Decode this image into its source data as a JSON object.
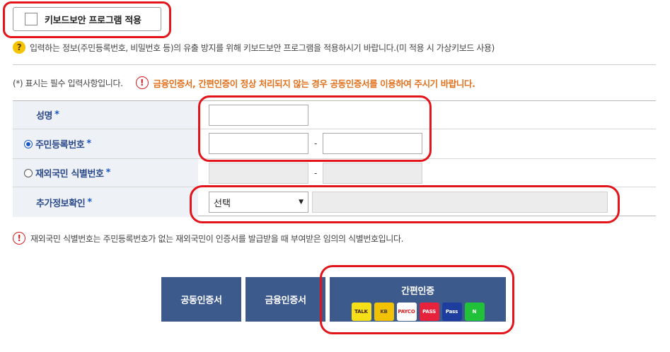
{
  "keyboard_security": {
    "label": "키보드보안 프로그램 적용"
  },
  "help": {
    "icon": "?",
    "text": "입력하는 정보(주민등록번호, 비밀번호 등)의 유출 방지를 위해 키보드보안 프로그램을 적용하시기 바랍니다.(미 적용 시 가상키보드 사용)"
  },
  "required_note": {
    "text": "(*) 표시는 필수 입력사항입니다.",
    "warning": "금융인증서, 간편인증이 정상 처리되지 않는 경우 공동인증서를 이용하여 주시기 바랍니다."
  },
  "form": {
    "rows": [
      {
        "label": "성명",
        "star": "*"
      },
      {
        "label": "주민등록번호",
        "star": "*"
      },
      {
        "label": "재외국민 식별번호",
        "star": "*"
      },
      {
        "label": "추가정보확인",
        "star": "*"
      }
    ],
    "dash": "-",
    "select_value": "선택",
    "select_caret": "▼"
  },
  "bottom_note": {
    "text": "재외국민 식별번호는 주민등록번호가 없는 재외국민이 인증서를 발급받을 때 부여받은 임의의 식별번호입니다."
  },
  "buttons": {
    "joint_cert": "공동인증서",
    "financial_cert": "금융인증서",
    "simple_auth": "간편인증"
  },
  "providers": [
    {
      "name": "kakao-icon",
      "label": "TALK",
      "bg": "#f7e017",
      "fg": "#3a1d1d"
    },
    {
      "name": "kb-icon",
      "label": "KB",
      "bg": "#f2c200",
      "fg": "#4a3b2a"
    },
    {
      "name": "payco-icon",
      "label": "PAYCO",
      "bg": "#ffffff",
      "fg": "#e2201f"
    },
    {
      "name": "pass-icon",
      "label": "PASS",
      "bg": "#e6223c",
      "fg": "#ffffff"
    },
    {
      "name": "samsung-pass-icon",
      "label": "Pass",
      "bg": "#1d3e9e",
      "fg": "#ffffff"
    },
    {
      "name": "naver-icon",
      "label": "N",
      "bg": "#21c13a",
      "fg": "#ffffff"
    }
  ],
  "colors": {
    "accent_blue": "#3d5a8c",
    "warning_orange": "#e2711d",
    "highlight_red": "#e3141a"
  }
}
